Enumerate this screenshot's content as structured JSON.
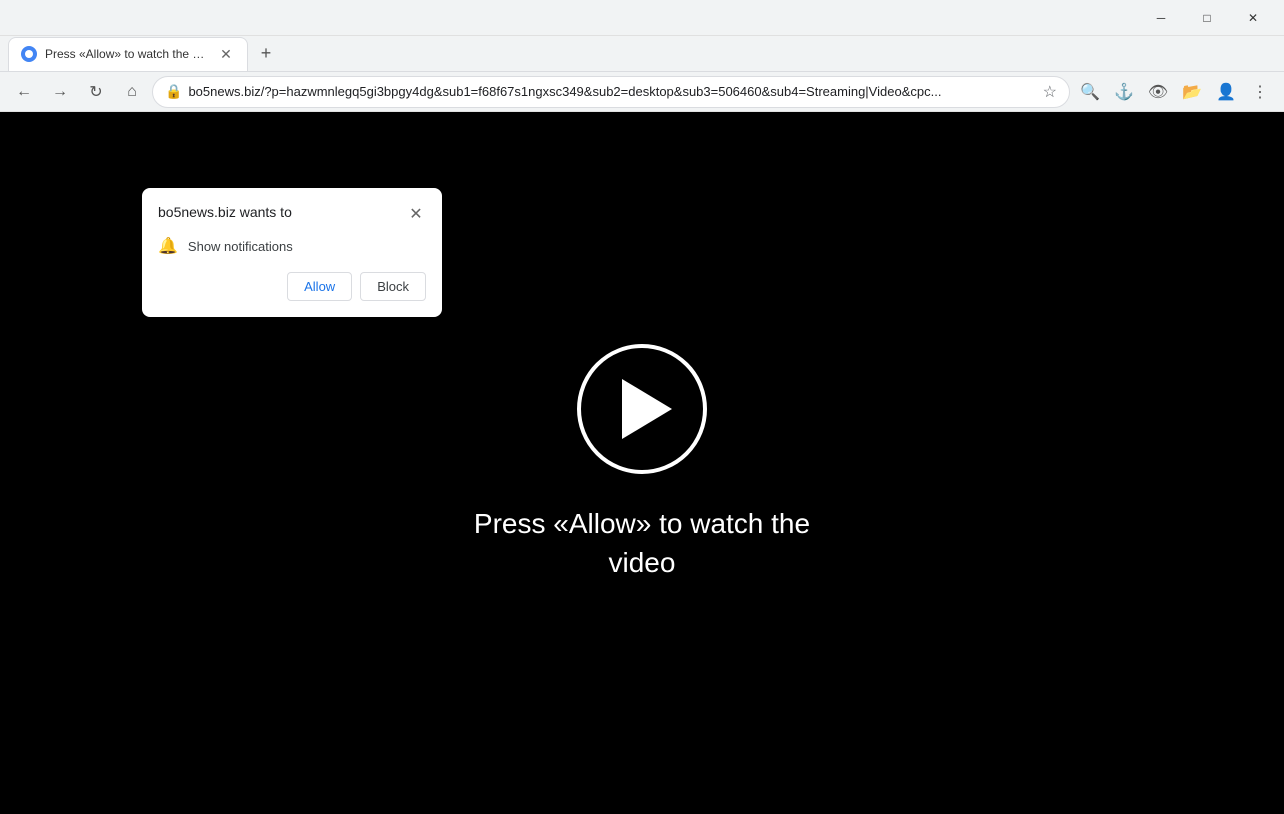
{
  "window": {
    "minimize_label": "─",
    "maximize_label": "□",
    "close_label": "✕"
  },
  "tab": {
    "title": "Press «Allow» to watch the video",
    "url": "bo5news.biz/?p=hazwmnlegq5gi3bpgy4dg&sub1=f68f67s1ngxsc349&sub2=desktop&sub3=506460&sub4=Streaming|Video&cpc..."
  },
  "nav": {
    "back_disabled": false,
    "forward_disabled": false,
    "full_url": "bo5news.biz/?p=hazwmnlegq5gi3bpgy4dg&sub1=f68f67s1ngxsc349&sub2=desktop&sub3=506460&sub4=Streaming|Video&cpc..."
  },
  "popup": {
    "title": "bo5news.biz wants to",
    "permission_label": "Show notifications",
    "allow_label": "Allow",
    "block_label": "Block"
  },
  "content": {
    "prompt_line1": "Press «Allow» to watch the",
    "prompt_line2": "video"
  }
}
